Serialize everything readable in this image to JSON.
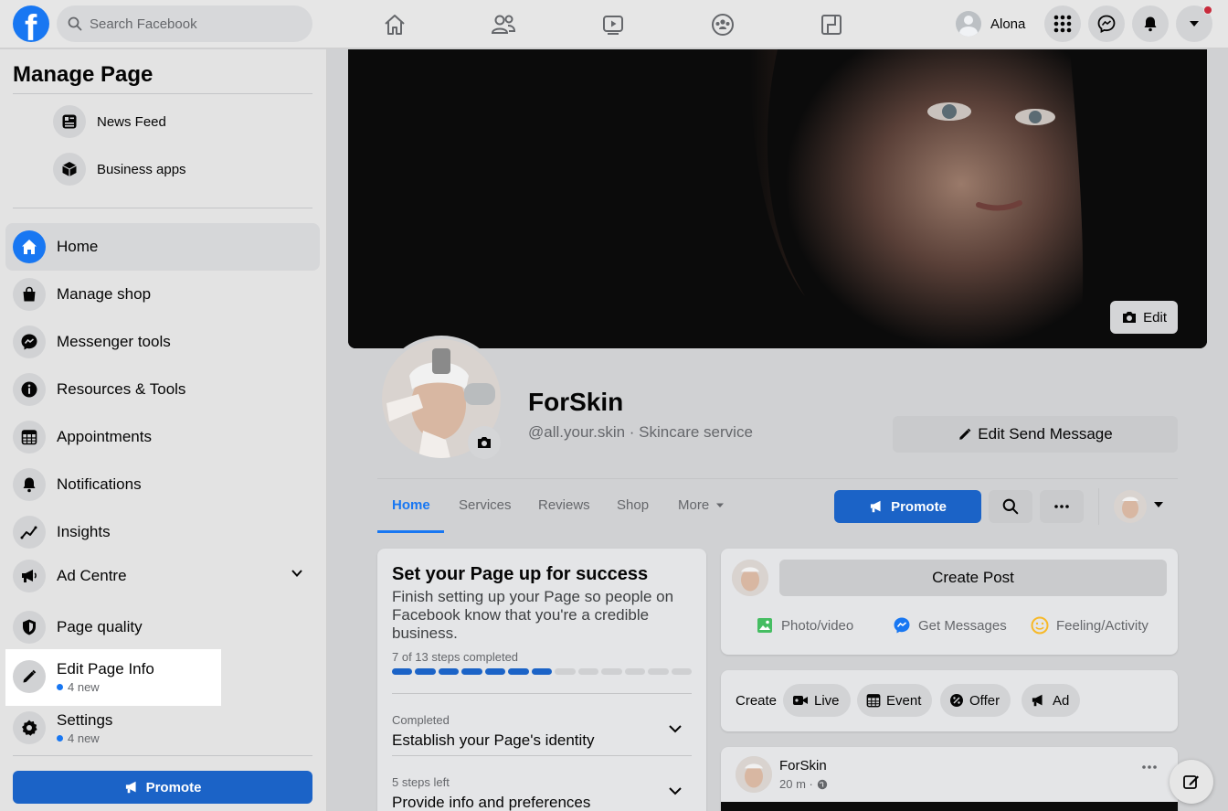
{
  "topbar": {
    "search_placeholder": "Search Facebook",
    "user_name": "Alona",
    "nav_icons": [
      "home-icon",
      "friends-icon",
      "watch-icon",
      "groups-icon",
      "gaming-icon"
    ]
  },
  "sidebar": {
    "title": "Manage Page",
    "sub_items": [
      {
        "label": "News Feed",
        "icon": "news-feed-icon"
      },
      {
        "label": "Business apps",
        "icon": "cube-icon"
      }
    ],
    "items": [
      {
        "label": "Home",
        "icon": "home-icon",
        "active": true
      },
      {
        "label": "Manage shop",
        "icon": "shopping-bag-icon"
      },
      {
        "label": "Messenger tools",
        "icon": "messenger-icon"
      },
      {
        "label": "Resources & Tools",
        "icon": "info-icon"
      },
      {
        "label": "Appointments",
        "icon": "calendar-icon"
      },
      {
        "label": "Notifications",
        "icon": "bell-icon"
      },
      {
        "label": "Insights",
        "icon": "insights-icon"
      },
      {
        "label": "Ad Centre",
        "icon": "megaphone-icon"
      },
      {
        "label": "Page quality",
        "icon": "shield-icon"
      },
      {
        "label": "Edit Page Info",
        "icon": "pencil-icon",
        "badge": "4 new"
      },
      {
        "label": "Settings",
        "icon": "gear-icon",
        "badge": "4 new"
      }
    ],
    "promote_label": "Promote"
  },
  "page": {
    "cover_edit_label": "Edit",
    "name": "ForSkin",
    "handle": "@all.your.skin · Skincare service",
    "edit_send_label": "Edit Send Message",
    "tabs": [
      "Home",
      "Services",
      "Reviews",
      "Shop",
      "More"
    ],
    "promote_label": "Promote"
  },
  "setup": {
    "title": "Set your Page up for success",
    "description": "Finish setting up your Page so people on Facebook know that you're a credible business.",
    "steps_text": "7 of 13 steps completed",
    "steps_done": 7,
    "steps_total": 13,
    "sections": [
      {
        "status": "Completed",
        "title": "Establish your Page's identity"
      },
      {
        "status": "5 steps left",
        "title": "Provide info and preferences"
      }
    ]
  },
  "composer": {
    "create_post_label": "Create Post",
    "actions": [
      "Photo/video",
      "Get Messages",
      "Feeling/Activity"
    ],
    "create_label": "Create",
    "chips": [
      "Live",
      "Event",
      "Offer",
      "Ad"
    ]
  },
  "feed": {
    "author": "ForSkin",
    "time": "20 m ·"
  },
  "colors": {
    "brand_blue": "#1877f2",
    "button_blue": "#1b63c7",
    "notification_red": "#c82a3b"
  }
}
